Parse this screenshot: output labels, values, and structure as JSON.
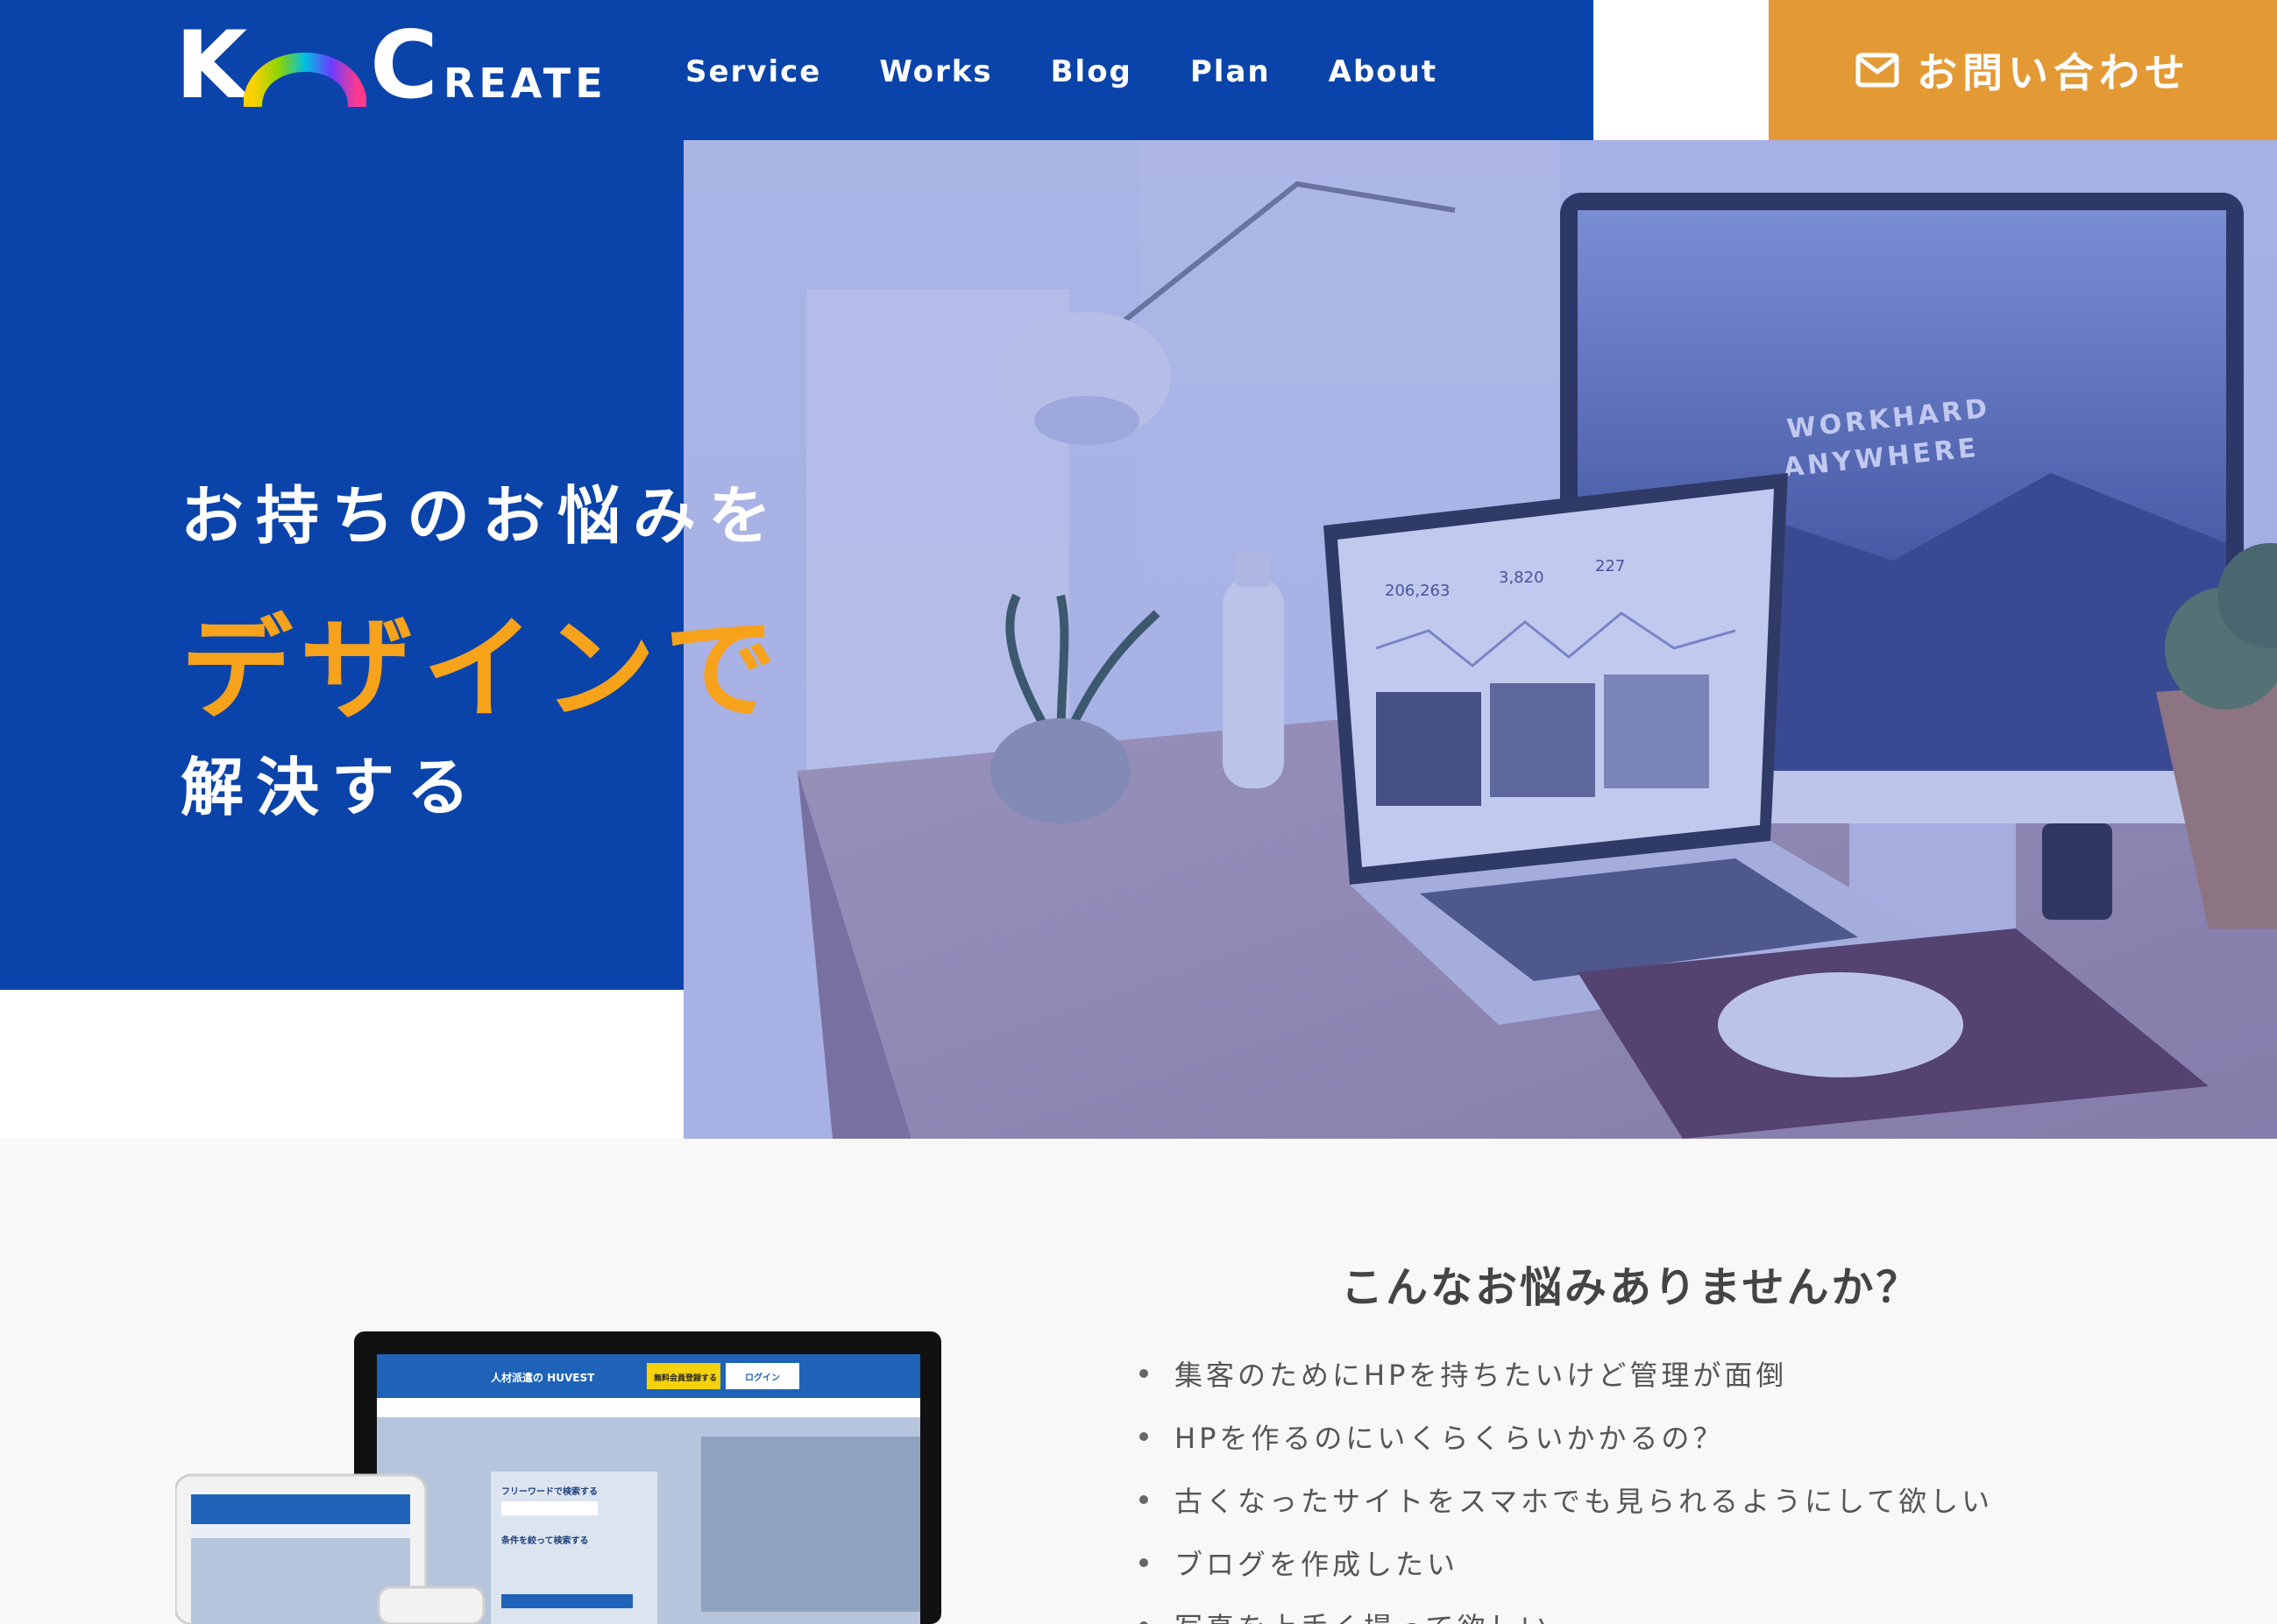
{
  "brand": {
    "logo_text": "KCCREATE",
    "colors": {
      "primary_blue": "#0a44aa",
      "accent_orange": "#e39a35",
      "highlight_orange": "#f7a21b"
    }
  },
  "nav": {
    "items": [
      {
        "label": "Service"
      },
      {
        "label": "Works"
      },
      {
        "label": "Blog"
      },
      {
        "label": "Plan"
      },
      {
        "label": "About"
      }
    ]
  },
  "contact": {
    "label": "お問い合わせ",
    "icon": "mail-icon"
  },
  "hero": {
    "line1": "お持ちのお悩みを",
    "line2": "デザインで",
    "line3": "解決する",
    "image_screen_text": [
      "WORKHARD",
      "ANYWHERE"
    ],
    "laptop_stats": [
      "206,263",
      "3,820",
      "227"
    ]
  },
  "problems": {
    "title": "こんなお悩みありませんか？",
    "items": [
      "集客のためにHPを持ちたいけど管理が面倒",
      "HPを作るのにいくらくらいかかるの？",
      "古くなったサイトをスマホでも見られるようにして欲しい",
      "ブログを作成したい",
      "写真を上手く撮って欲しい"
    ],
    "mockup_text": {
      "brand": "人材派遣の HUVEST",
      "register": "無料会員登録する",
      "login": "ログイン",
      "search_free": "フリーワードで検索する",
      "search_cond": "条件を絞って検索する"
    }
  }
}
